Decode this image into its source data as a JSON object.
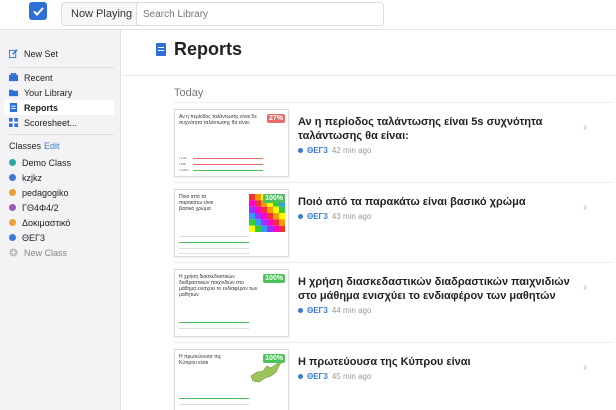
{
  "topbar": {
    "now_playing_label": "Now Playing",
    "search_placeholder": "Search Library"
  },
  "sidebar": {
    "new_set_label": "New Set",
    "nav": [
      {
        "label": "Recent",
        "icon": "clock-icon"
      },
      {
        "label": "Your Library",
        "icon": "folder-icon"
      },
      {
        "label": "Reports",
        "icon": "report-icon",
        "active": true
      },
      {
        "label": "Scoresheet...",
        "icon": "grid-icon"
      }
    ],
    "classes_header": "Classes",
    "classes_edit": "Edit",
    "classes": [
      {
        "label": "Demo Class",
        "color": "#2ba8a0"
      },
      {
        "label": "kzjkz",
        "color": "#3a7bd5"
      },
      {
        "label": "pedagogiko",
        "color": "#f0a032"
      },
      {
        "label": "ΓΘ4Φ4/2",
        "color": "#9b59b6"
      },
      {
        "label": "Δοκιμαστικό",
        "color": "#f0a032"
      },
      {
        "label": "ΘΕΓ3",
        "color": "#3a7bd5"
      }
    ],
    "new_class_label": "New Class"
  },
  "main": {
    "title": "Reports",
    "section": "Today",
    "reports": [
      {
        "question": "Αν η περίοδος ταλάντωσης είναι 5s συχνότητα ταλάντωσης θα είναι:",
        "class": "ΘΕΓ3",
        "time": "42 min ago",
        "thumb_text": "Αν η περίοδος ταλάντωσης είναι 5s συχνότητα ταλάντωσης θα είναι:",
        "score": "27%",
        "score_color": "#e86a6a"
      },
      {
        "question": "Ποιό από τα παρακάτω είναι βασικό χρώμα",
        "class": "ΘΕΓ3",
        "time": "43 min ago",
        "thumb_text": "Ποιό από τα παρακάτω είναι βασικό χρώμα",
        "score": "100%",
        "score_color": "#4cc35a"
      },
      {
        "question": "Η χρήση διασκεδαστικών διαδραστικών παιχνιδιών στο μάθημα ενισχύει το ενδιαφέρον των μαθητών",
        "class": "ΘΕΓ3",
        "time": "44 min ago",
        "thumb_text": "Η χρήση διασκεδαστικών διαδραστικών παιχνιδιών στο μάθημα ενισχύει το ενδιαφέρον των μαθητών",
        "score": "100%",
        "score_color": "#4cc35a"
      },
      {
        "question": "Η πρωτεύουσα της Κύπρου είναι",
        "class": "ΘΕΓ3",
        "time": "45 min ago",
        "thumb_text": "Η πρωτεύουσα της Κύπρου είναι",
        "score": "100%",
        "score_color": "#4cc35a"
      }
    ]
  },
  "colors": {
    "accent": "#2f6fd9",
    "link": "#3a7bd5"
  }
}
